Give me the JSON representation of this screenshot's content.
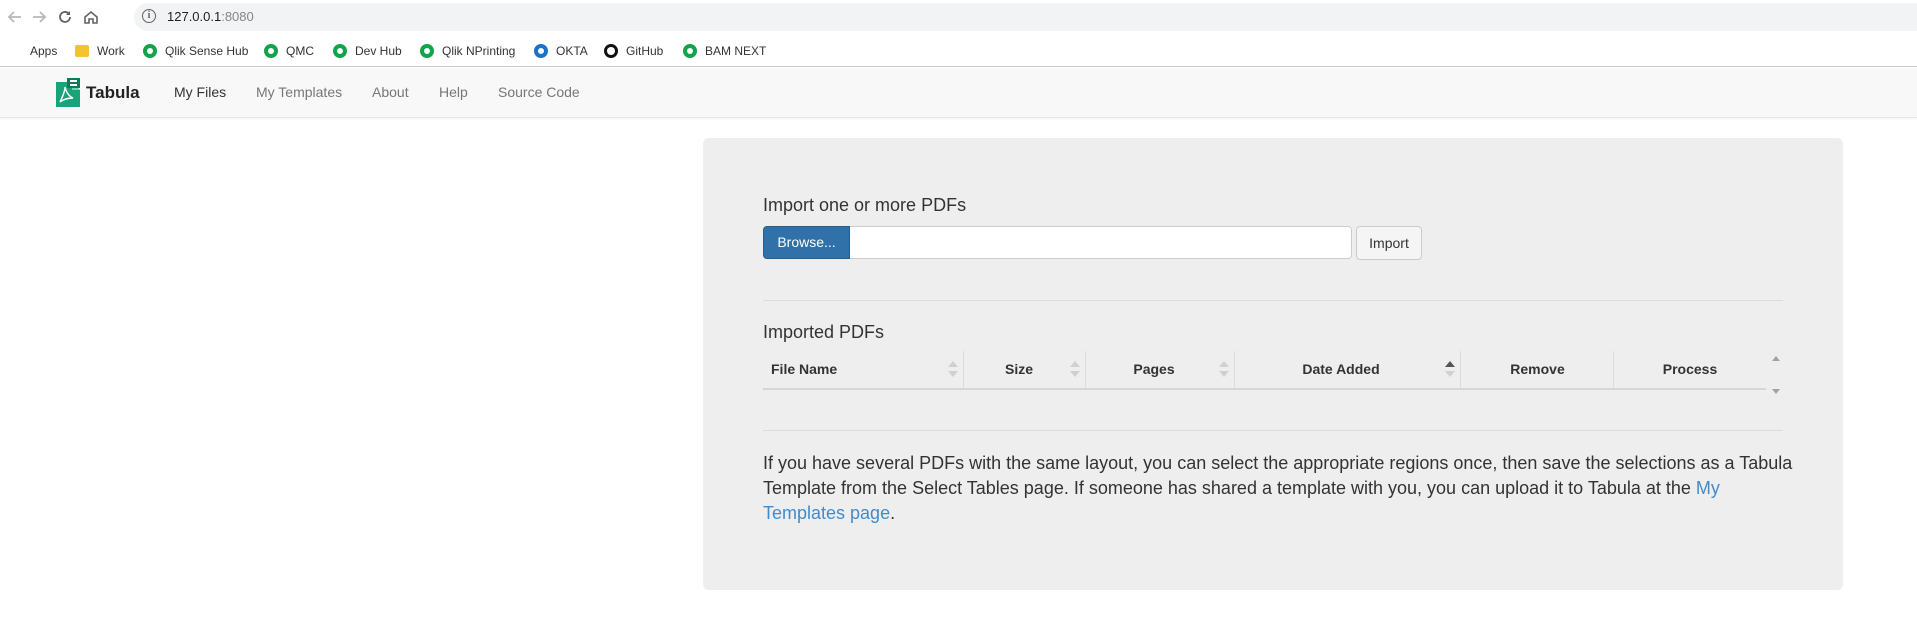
{
  "browser": {
    "url_host": "127.0.0.1",
    "url_port": ":8080",
    "bookmarks": [
      {
        "label": "Apps",
        "icon": "apps-grid-icon"
      },
      {
        "label": "Work",
        "icon": "folder-icon"
      },
      {
        "label": "Qlik Sense Hub",
        "icon": "qlik-icon"
      },
      {
        "label": "QMC",
        "icon": "qlik-icon"
      },
      {
        "label": "Dev Hub",
        "icon": "qlik-icon"
      },
      {
        "label": "Qlik NPrinting",
        "icon": "qlik-icon"
      },
      {
        "label": "OKTA",
        "icon": "okta-icon"
      },
      {
        "label": "GitHub",
        "icon": "github-icon"
      },
      {
        "label": "BAM NEXT",
        "icon": "qlik-icon"
      }
    ]
  },
  "navbar": {
    "brand": "Tabula",
    "links": [
      {
        "label": "My Files",
        "active": true
      },
      {
        "label": "My Templates",
        "active": false
      },
      {
        "label": "About",
        "active": false
      },
      {
        "label": "Help",
        "active": false
      },
      {
        "label": "Source Code",
        "active": false
      }
    ]
  },
  "upload": {
    "heading": "Import one or more PDFs",
    "browse_label": "Browse...",
    "file_value": "",
    "import_label": "Import"
  },
  "imported": {
    "heading": "Imported PDFs",
    "columns": [
      "File Name",
      "Size",
      "Pages",
      "Date Added",
      "Remove",
      "Process"
    ],
    "rows": []
  },
  "templates_note": {
    "text": "If you have several PDFs with the same layout, you can select the appropriate regions once, then save the selections as a Tabula Template from the Select Tables page. If someone has shared a template with you, you can upload it to Tabula at the ",
    "link": "My Templates page",
    "suffix": "."
  },
  "colors": {
    "primary": "#3071a9",
    "link": "#428bca",
    "panel": "#eeeeee",
    "brand_green": "#1aa37a"
  }
}
